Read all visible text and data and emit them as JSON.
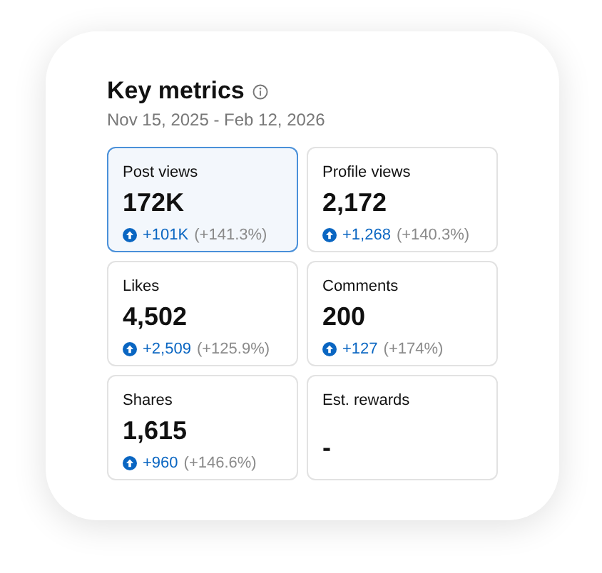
{
  "title": "Key metrics",
  "date_range": "Nov 15, 2025 - Feb 12, 2026",
  "metrics": [
    {
      "label": "Post views",
      "value": "172K",
      "selected": true,
      "delta": "+101K",
      "percent": "(+141.3%)"
    },
    {
      "label": "Profile views",
      "value": "2,172",
      "selected": false,
      "delta": "+1,268",
      "percent": "(+140.3%)"
    },
    {
      "label": "Likes",
      "value": "4,502",
      "selected": false,
      "delta": "+2,509",
      "percent": "(+125.9%)"
    },
    {
      "label": "Comments",
      "value": "200",
      "selected": false,
      "delta": "+127",
      "percent": "(+174%)"
    },
    {
      "label": "Shares",
      "value": "1,615",
      "selected": false,
      "delta": "+960",
      "percent": "(+146.6%)"
    },
    {
      "label": "Est. rewards",
      "value": "-",
      "selected": false
    }
  ]
}
